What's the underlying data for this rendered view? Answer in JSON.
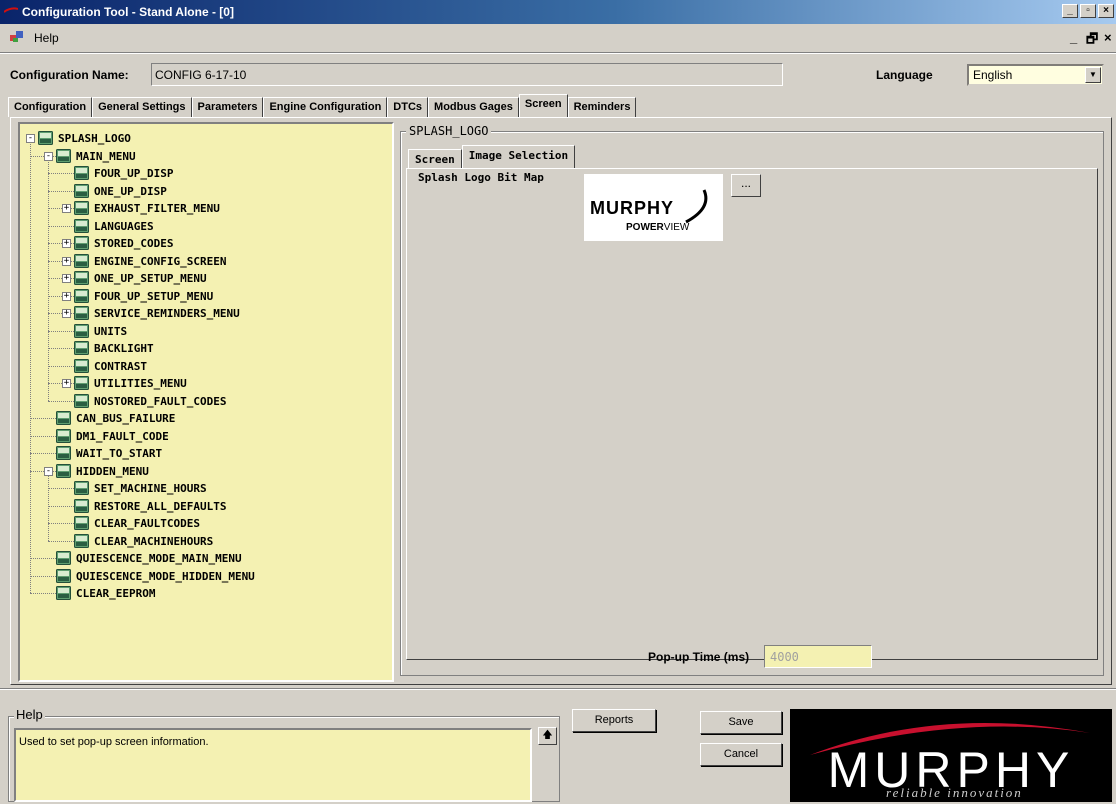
{
  "window": {
    "title": "Configuration Tool - Stand Alone - [0]"
  },
  "menubar": {
    "help": "Help"
  },
  "config": {
    "name_label": "Configuration Name:",
    "name_value": "CONFIG 6-17-10"
  },
  "language": {
    "label": "Language",
    "value": "English"
  },
  "tabs": [
    "Configuration",
    "General Settings",
    "Parameters",
    "Engine Configuration",
    "DTCs",
    "Modbus Gages",
    "Screen",
    "Reminders"
  ],
  "tree": [
    {
      "label": "SPLASH_LOGO"
    },
    {
      "label": "MAIN_MENU"
    },
    {
      "label": "FOUR_UP_DISP"
    },
    {
      "label": "ONE_UP_DISP"
    },
    {
      "label": "EXHAUST_FILTER_MENU"
    },
    {
      "label": "LANGUAGES"
    },
    {
      "label": "STORED_CODES"
    },
    {
      "label": "ENGINE_CONFIG_SCREEN"
    },
    {
      "label": "ONE_UP_SETUP_MENU"
    },
    {
      "label": "FOUR_UP_SETUP_MENU"
    },
    {
      "label": "SERVICE_REMINDERS_MENU"
    },
    {
      "label": "UNITS"
    },
    {
      "label": "BACKLIGHT"
    },
    {
      "label": "CONTRAST"
    },
    {
      "label": "UTILITIES_MENU"
    },
    {
      "label": "NOSTORED_FAULT_CODES"
    },
    {
      "label": "CAN_BUS_FAILURE"
    },
    {
      "label": "DM1_FAULT_CODE"
    },
    {
      "label": "WAIT_TO_START"
    },
    {
      "label": "HIDDEN_MENU"
    },
    {
      "label": "SET_MACHINE_HOURS"
    },
    {
      "label": "RESTORE_ALL_DEFAULTS"
    },
    {
      "label": "CLEAR_FAULTCODES"
    },
    {
      "label": "CLEAR_MACHINEHOURS"
    },
    {
      "label": "QUIESCENCE_MODE_MAIN_MENU"
    },
    {
      "label": "QUIESCENCE_MODE_HIDDEN_MENU"
    },
    {
      "label": "CLEAR_EEPROM"
    }
  ],
  "panel": {
    "group_title": "SPLASH_LOGO",
    "tabs": [
      "Screen",
      "Image Selection"
    ],
    "splash_label": "Splash Logo Bit Map",
    "logo_brand": "MURPHY",
    "logo_power": "POWER",
    "logo_view": "VIEW",
    "browse_label": "...",
    "popup_label": "Pop-up Time (ms)",
    "popup_value": "4000"
  },
  "help": {
    "label": "Help",
    "text": "Used to set pop-up screen  information."
  },
  "buttons": {
    "reports": "Reports",
    "save": "Save",
    "cancel": "Cancel"
  },
  "brand": {
    "name": "MURPHY",
    "tagline": "reliable innovation"
  },
  "colors": {
    "tree_bg": "#f4f1b2",
    "title_blue": "#0a246a",
    "brand_red": "#c8102e"
  }
}
